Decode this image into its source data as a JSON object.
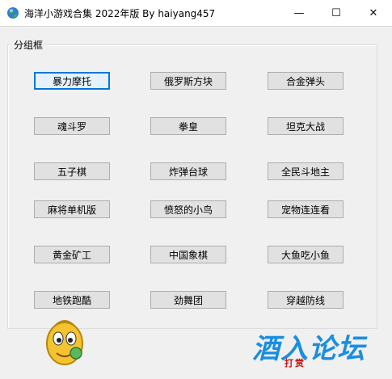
{
  "window": {
    "title": "海洋小游戏合集 2022年版  By haiyang457",
    "minimize_glyph": "—",
    "maximize_glyph": "☐",
    "close_glyph": "✕"
  },
  "group": {
    "label": "分组框",
    "buttons": [
      [
        "暴力摩托",
        "俄罗斯方块",
        "合金弹头"
      ],
      [
        "魂斗罗",
        "拳皇",
        "坦克大战"
      ],
      [
        "五子棋",
        "炸弹台球",
        "全民斗地主"
      ],
      [
        "麻将单机版",
        "愤怒的小鸟",
        "宠物连连看"
      ],
      [
        "黄金矿工",
        "中国象棋",
        "大鱼吃小鱼"
      ],
      [
        "地铁跑酷",
        "劲舞团",
        "穿越防线"
      ]
    ]
  },
  "watermark": {
    "main": "酒入论坛",
    "sub": "打赏"
  },
  "icons": {
    "app": "globe-icon",
    "mascot": "mascot-icon"
  },
  "colors": {
    "focus": "#0078d7",
    "watermark": "#1a8ee0",
    "watermark_sub": "#c81010"
  }
}
